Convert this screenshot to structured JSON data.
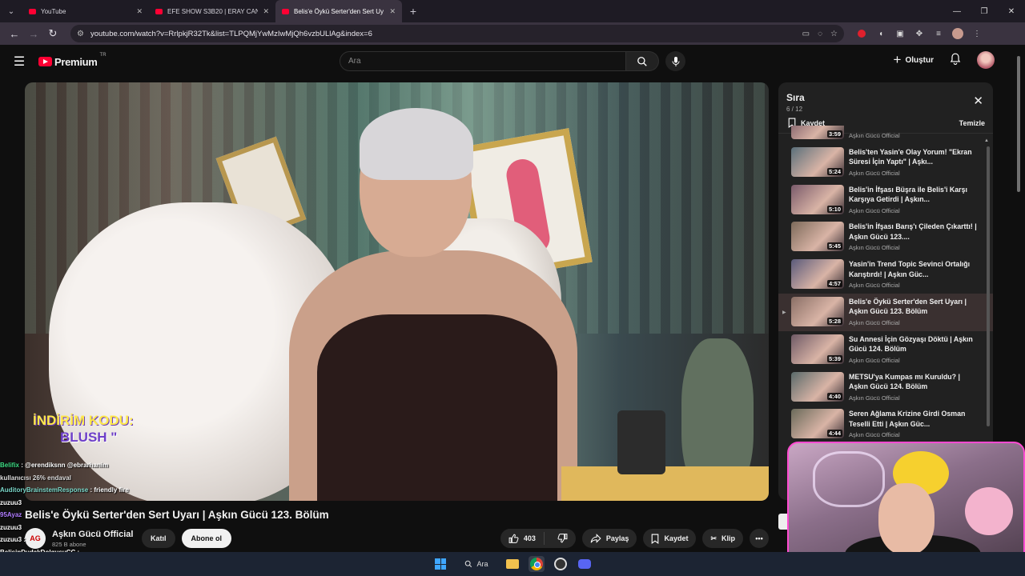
{
  "browser": {
    "tabs": [
      {
        "title": "YouTube",
        "active": false
      },
      {
        "title": "EFE SHOW S3B20 | ERAY CAN Ö",
        "active": false
      },
      {
        "title": "Belis'e Öykü Serter'den Sert Uy",
        "active": true
      }
    ],
    "url": "youtube.com/watch?v=RrlpkjR32Tk&list=TLPQMjYwMzIwMjQh6vzbULlAg&index=6"
  },
  "header": {
    "logo_text": "Premium",
    "logo_sup": "TR",
    "search_placeholder": "Ara",
    "create_label": "Oluştur"
  },
  "video": {
    "overlay_line1": "İNDİRİM KODU:",
    "overlay_line2": "BLUSH \"",
    "title": "Belis'e Öykü Serter'den Sert Uyarı | Aşkın Gücü 123. Bölüm",
    "channel_name": "Aşkın Gücü Official",
    "subscribers": "825 B abone",
    "join_label": "Katıl",
    "subscribe_label": "Abone ol",
    "likes": "403",
    "share_label": "Paylaş",
    "save_label": "Kaydet",
    "clip_label": "Klip"
  },
  "queue": {
    "title": "Sıra",
    "position": "6 / 12",
    "save_label": "Kaydet",
    "clear_label": "Temizle",
    "items": [
      {
        "title": "",
        "channel": "Aşkın Gücü Official",
        "duration": "3:59",
        "thumb": "#6a4a5a",
        "current": false
      },
      {
        "title": "Belis'ten Yasin'e Olay Yorum! \"Ekran Süresi İçin Yaptı\" | Aşkı...",
        "channel": "Aşkın Gücü Official",
        "duration": "5:24",
        "thumb": "#5a6f7a",
        "current": false
      },
      {
        "title": "Belis'in İfşası Büşra ile Belis'i Karşı Karşıya Getirdi | Aşkın...",
        "channel": "Aşkın Gücü Official",
        "duration": "5:10",
        "thumb": "#7a5a6a",
        "current": false
      },
      {
        "title": "Belis'in İfşası Barış'ı Çileden Çıkarttı! | Aşkın Gücü 123....",
        "channel": "Aşkın Gücü Official",
        "duration": "5:45",
        "thumb": "#7d6a5a",
        "current": false
      },
      {
        "title": "Yasin'in Trend Topic Sevinci Ortalığı Karıştırdı! | Aşkın Güc...",
        "channel": "Aşkın Gücü Official",
        "duration": "4:57",
        "thumb": "#5a5a7a",
        "current": false
      },
      {
        "title": "Belis'e Öykü Serter'den Sert Uyarı | Aşkın Gücü 123. Bölüm",
        "channel": "Aşkın Gücü Official",
        "duration": "5:28",
        "thumb": "#8a6f66",
        "current": true
      },
      {
        "title": "Su Annesi İçin Gözyaşı Döktü | Aşkın Gücü 124. Bölüm",
        "channel": "Aşkın Gücü Official",
        "duration": "5:39",
        "thumb": "#6f5a66",
        "current": false
      },
      {
        "title": "METSU'ya Kumpas mı Kuruldu? | Aşkın Gücü 124. Bölüm",
        "channel": "Aşkın Gücü Official",
        "duration": "4:40",
        "thumb": "#5a6a6a",
        "current": false
      },
      {
        "title": "Seren Ağlama Krizine Girdi Osman Teselli Etti | Aşkın Güc...",
        "channel": "Aşkın Gücü Official",
        "duration": "4:44",
        "thumb": "#6a6a5a",
        "current": false
      }
    ]
  },
  "chat": [
    {
      "user": "Belifix",
      "text": ": @erendiksnn @ebrarhanim",
      "color": "u-green"
    },
    {
      "user": "",
      "text": "kullanıcısı 26% endaval",
      "color": "u-gray"
    },
    {
      "user": "AuditoryBrainstemResponse",
      "text": ": friendly fire",
      "color": "u-teal"
    },
    {
      "user": "zuzuu3",
      "text": "",
      "color": "u-white"
    },
    {
      "user": "95Ayaz",
      "text": "",
      "color": "u-purple"
    },
    {
      "user": "zuzuu3",
      "text": "",
      "color": "u-white"
    },
    {
      "user": "zuzuu3",
      "text": ":",
      "color": "u-white"
    },
    {
      "user": "BelisinDudakDolgusuCC",
      "text": ":",
      "color": "u-white"
    }
  ],
  "taskbar": {
    "search_label": "Ara"
  }
}
